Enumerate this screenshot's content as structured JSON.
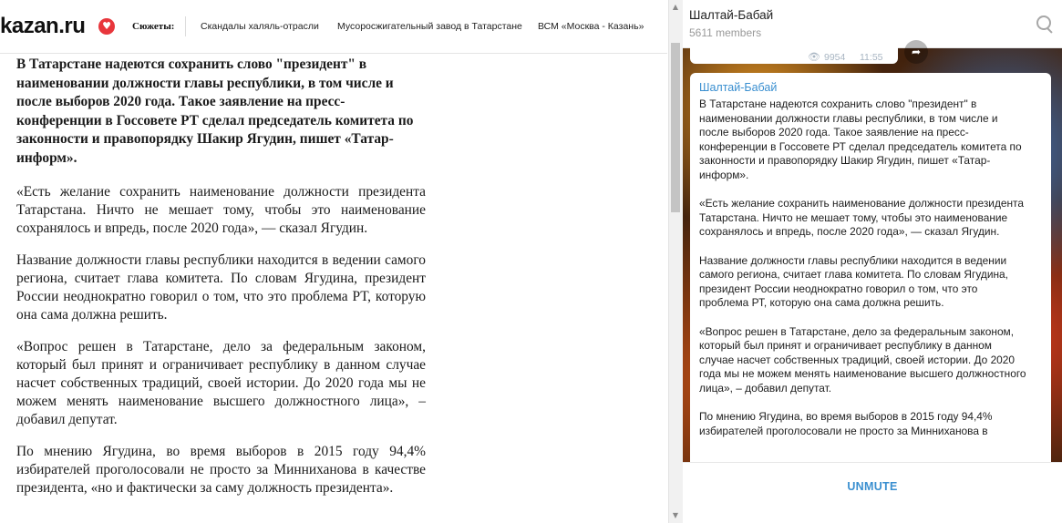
{
  "site": {
    "logo": "kazan.ru",
    "topics_label": "Сюжеты:",
    "topics": [
      "Скандалы халяль-отрасли",
      "Мусоросжигательный завод в Татарстане",
      "ВСМ «Москва - Казань»"
    ]
  },
  "article": {
    "lead": "В Татарстане надеются сохранить слово \"президент\" в наименовании должности главы республики, в том числе и после выборов 2020 года. Такое заявление на пресс-конференции в Госсовете РТ сделал председатель комитета по законности и правопорядку Шакир Ягудин, пишет «Татар-информ».",
    "paragraphs": [
      "«Есть желание сохранить наименование должности президента Татарстана. Ничто не мешает тому, чтобы это наименование сохранялось и впредь, после 2020 года», — сказал Ягудин.",
      "Название должности главы республики находится в ведении самого региона, считает глава комитета. По словам Ягудина, президент России неоднократно говорил о том, что это проблема РТ, которую она сама должна решить.",
      "«Вопрос решен в Татарстане, дело за федеральным законом, который был принят и ограничивает республику в данном случае насчет собственных традиций, своей истории. До 2020 года мы не можем менять наименование высшего должностного лица», – добавил депутат.",
      "По мнению Ягудина, во время выборов в 2015 году 94,4% избирателей проголосовали не просто за Минниханова в качестве президента, «но и фактически за саму должность президента»."
    ]
  },
  "telegram": {
    "channel_title": "Шалтай-Бабай",
    "members": "5611 members",
    "prev_views": "9954",
    "prev_time": "11:55",
    "message": {
      "author": "Шалтай-Бабай",
      "paragraphs": [
        "В Татарстане надеются сохранить слово \"президент\" в наименовании должности главы республики, в том числе и после выборов 2020 года. Такое заявление на пресс-конференции в Госсовете РТ сделал председатель комитета по законности и правопорядку Шакир Ягудин, пишет «Татар-информ».",
        "«Есть желание сохранить наименование должности президента Татарстана. Ничто не мешает тому, чтобы это наименование сохранялось и впредь, после 2020 года», — сказал Ягудин.",
        "Название должности главы республики находится в ведении самого региона, считает глава комитета. По словам Ягудина, президент России неоднократно говорил о том, что это проблема РТ, которую она сама должна решить.",
        "«Вопрос решен в Татарстане, дело за федеральным законом, который был принят и ограничивает республику в данном случае насчет собственных традиций, своей истории. До 2020 года мы не можем менять наименование высшего должностного лица», – добавил депутат.",
        "По мнению Ягудина, во время выборов в 2015 году 94,4% избирателей проголосовали не просто за Минниханова в"
      ]
    },
    "unmute_label": "UNMUTE"
  },
  "icons": {
    "logo_heart": "heart-icon",
    "search": "search-icon",
    "views": "eye-icon",
    "share": "share-icon"
  },
  "colors": {
    "logo_accent": "#e8363c",
    "telegram_accent": "#3a8fd0"
  }
}
